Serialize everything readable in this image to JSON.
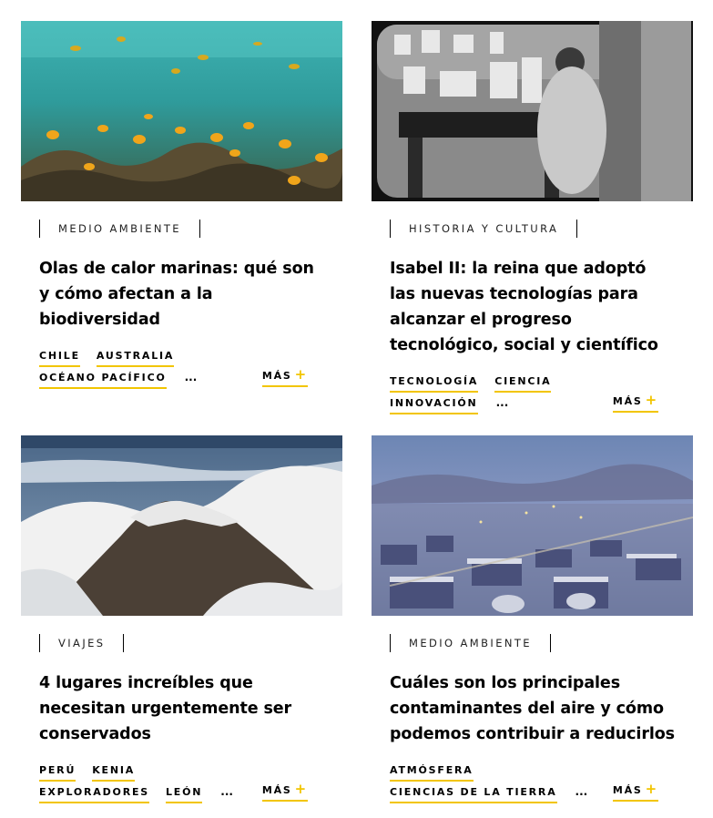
{
  "colors": {
    "accent": "#f2c500",
    "text": "#000000"
  },
  "cards": [
    {
      "category": "MEDIO AMBIENTE",
      "title": "Olas de calor marinas: qué son y cómo afectan a la biodiversidad",
      "tag_rows": [
        [
          "CHILE",
          "AUSTRALIA"
        ],
        [
          "OCÉANO PACÍFICO"
        ]
      ],
      "ellipsis": "...",
      "more": "MÁS",
      "image": "underwater-reef-fish"
    },
    {
      "category": "HISTORIA Y CULTURA",
      "title": "Isabel II: la reina que adoptó las nuevas tecnologías para alcanzar el progreso tecnológico, social y científico",
      "tag_rows": [
        [
          "TECNOLOGÍA",
          "CIENCIA"
        ],
        [
          "INNOVACIÓN"
        ]
      ],
      "ellipsis": "...",
      "more": "MÁS",
      "image": "black-white-tv-broadcast"
    },
    {
      "category": "VIAJES",
      "title": "4 lugares increíbles que necesitan urgentemente ser conservados",
      "tag_rows": [
        [
          "PERÚ",
          "KENIA"
        ],
        [
          "EXPLORADORES",
          "LEÓN"
        ]
      ],
      "ellipsis": "...",
      "more": "MÁS",
      "image": "aerial-mountain-clouds"
    },
    {
      "category": "MEDIO AMBIENTE",
      "title": "Cuáles son los principales contaminantes del aire y cómo podemos contribuir a reducirlos",
      "tag_rows": [
        [
          "ATMÓSFERA"
        ],
        [
          "CIENCIAS DE LA TIERRA"
        ]
      ],
      "ellipsis": "...",
      "more": "MÁS",
      "image": "smoggy-city-dusk"
    }
  ]
}
